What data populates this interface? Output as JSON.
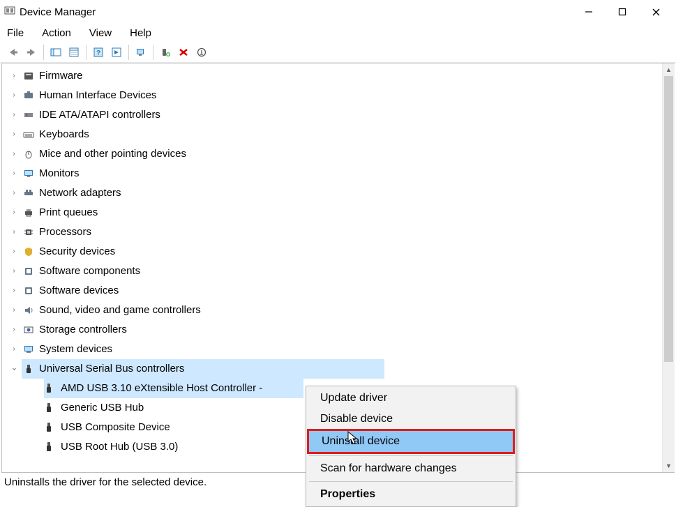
{
  "window": {
    "title": "Device Manager"
  },
  "menu": {
    "file": "File",
    "action": "Action",
    "view": "View",
    "help": "Help"
  },
  "tree": {
    "categories": [
      {
        "label": "Firmware",
        "icon": "firmware",
        "expanded": false
      },
      {
        "label": "Human Interface Devices",
        "icon": "hid",
        "expanded": false
      },
      {
        "label": "IDE ATA/ATAPI controllers",
        "icon": "ide",
        "expanded": false
      },
      {
        "label": "Keyboards",
        "icon": "keyboard",
        "expanded": false
      },
      {
        "label": "Mice and other pointing devices",
        "icon": "mouse",
        "expanded": false
      },
      {
        "label": "Monitors",
        "icon": "monitor",
        "expanded": false
      },
      {
        "label": "Network adapters",
        "icon": "network",
        "expanded": false
      },
      {
        "label": "Print queues",
        "icon": "printer",
        "expanded": false
      },
      {
        "label": "Processors",
        "icon": "cpu",
        "expanded": false
      },
      {
        "label": "Security devices",
        "icon": "security",
        "expanded": false
      },
      {
        "label": "Software components",
        "icon": "software",
        "expanded": false
      },
      {
        "label": "Software devices",
        "icon": "software",
        "expanded": false
      },
      {
        "label": "Sound, video and game controllers",
        "icon": "sound",
        "expanded": false
      },
      {
        "label": "Storage controllers",
        "icon": "storage",
        "expanded": false
      },
      {
        "label": "System devices",
        "icon": "system",
        "expanded": false
      },
      {
        "label": "Universal Serial Bus controllers",
        "icon": "usb",
        "expanded": true,
        "children": [
          {
            "label": "AMD USB 3.10 eXtensible Host Controller - ",
            "selected": true
          },
          {
            "label": "Generic USB Hub"
          },
          {
            "label": "USB Composite Device"
          },
          {
            "label": "USB Root Hub (USB 3.0)"
          }
        ]
      }
    ]
  },
  "context_menu": {
    "update": "Update driver",
    "disable": "Disable device",
    "uninstall": "Uninstall device",
    "scan": "Scan for hardware changes",
    "properties": "Properties"
  },
  "status": {
    "text": "Uninstalls the driver for the selected device."
  }
}
